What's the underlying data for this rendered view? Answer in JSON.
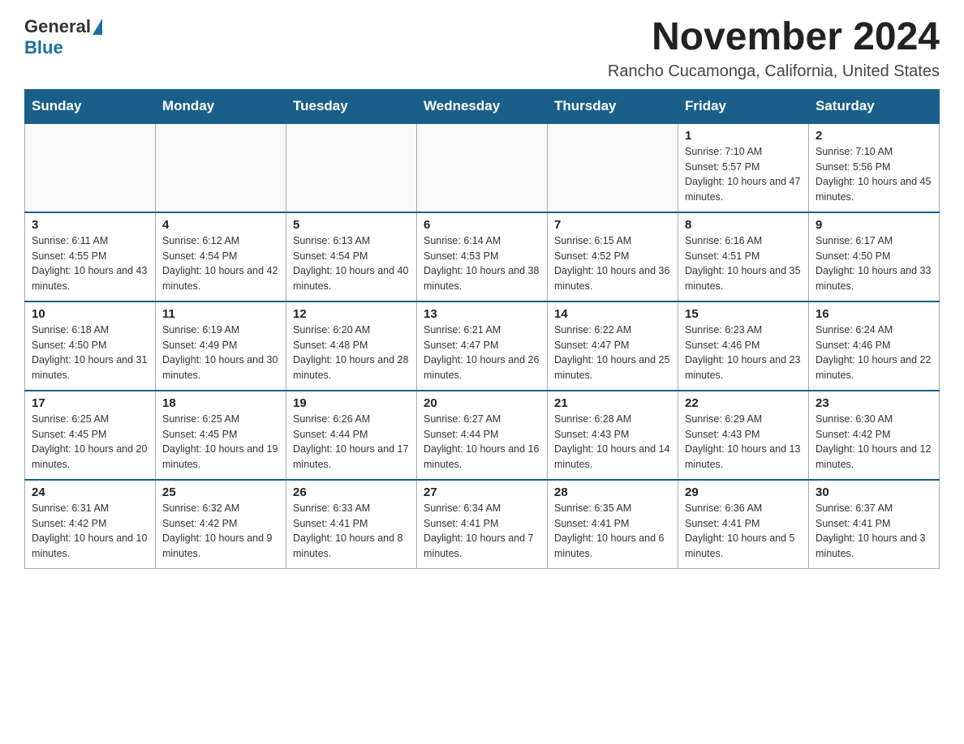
{
  "logo": {
    "general": "General",
    "blue": "Blue"
  },
  "title": {
    "month_year": "November 2024",
    "location": "Rancho Cucamonga, California, United States"
  },
  "days_of_week": [
    "Sunday",
    "Monday",
    "Tuesday",
    "Wednesday",
    "Thursday",
    "Friday",
    "Saturday"
  ],
  "weeks": [
    [
      {
        "day": "",
        "info": ""
      },
      {
        "day": "",
        "info": ""
      },
      {
        "day": "",
        "info": ""
      },
      {
        "day": "",
        "info": ""
      },
      {
        "day": "",
        "info": ""
      },
      {
        "day": "1",
        "info": "Sunrise: 7:10 AM\nSunset: 5:57 PM\nDaylight: 10 hours and 47 minutes."
      },
      {
        "day": "2",
        "info": "Sunrise: 7:10 AM\nSunset: 5:56 PM\nDaylight: 10 hours and 45 minutes."
      }
    ],
    [
      {
        "day": "3",
        "info": "Sunrise: 6:11 AM\nSunset: 4:55 PM\nDaylight: 10 hours and 43 minutes."
      },
      {
        "day": "4",
        "info": "Sunrise: 6:12 AM\nSunset: 4:54 PM\nDaylight: 10 hours and 42 minutes."
      },
      {
        "day": "5",
        "info": "Sunrise: 6:13 AM\nSunset: 4:54 PM\nDaylight: 10 hours and 40 minutes."
      },
      {
        "day": "6",
        "info": "Sunrise: 6:14 AM\nSunset: 4:53 PM\nDaylight: 10 hours and 38 minutes."
      },
      {
        "day": "7",
        "info": "Sunrise: 6:15 AM\nSunset: 4:52 PM\nDaylight: 10 hours and 36 minutes."
      },
      {
        "day": "8",
        "info": "Sunrise: 6:16 AM\nSunset: 4:51 PM\nDaylight: 10 hours and 35 minutes."
      },
      {
        "day": "9",
        "info": "Sunrise: 6:17 AM\nSunset: 4:50 PM\nDaylight: 10 hours and 33 minutes."
      }
    ],
    [
      {
        "day": "10",
        "info": "Sunrise: 6:18 AM\nSunset: 4:50 PM\nDaylight: 10 hours and 31 minutes."
      },
      {
        "day": "11",
        "info": "Sunrise: 6:19 AM\nSunset: 4:49 PM\nDaylight: 10 hours and 30 minutes."
      },
      {
        "day": "12",
        "info": "Sunrise: 6:20 AM\nSunset: 4:48 PM\nDaylight: 10 hours and 28 minutes."
      },
      {
        "day": "13",
        "info": "Sunrise: 6:21 AM\nSunset: 4:47 PM\nDaylight: 10 hours and 26 minutes."
      },
      {
        "day": "14",
        "info": "Sunrise: 6:22 AM\nSunset: 4:47 PM\nDaylight: 10 hours and 25 minutes."
      },
      {
        "day": "15",
        "info": "Sunrise: 6:23 AM\nSunset: 4:46 PM\nDaylight: 10 hours and 23 minutes."
      },
      {
        "day": "16",
        "info": "Sunrise: 6:24 AM\nSunset: 4:46 PM\nDaylight: 10 hours and 22 minutes."
      }
    ],
    [
      {
        "day": "17",
        "info": "Sunrise: 6:25 AM\nSunset: 4:45 PM\nDaylight: 10 hours and 20 minutes."
      },
      {
        "day": "18",
        "info": "Sunrise: 6:25 AM\nSunset: 4:45 PM\nDaylight: 10 hours and 19 minutes."
      },
      {
        "day": "19",
        "info": "Sunrise: 6:26 AM\nSunset: 4:44 PM\nDaylight: 10 hours and 17 minutes."
      },
      {
        "day": "20",
        "info": "Sunrise: 6:27 AM\nSunset: 4:44 PM\nDaylight: 10 hours and 16 minutes."
      },
      {
        "day": "21",
        "info": "Sunrise: 6:28 AM\nSunset: 4:43 PM\nDaylight: 10 hours and 14 minutes."
      },
      {
        "day": "22",
        "info": "Sunrise: 6:29 AM\nSunset: 4:43 PM\nDaylight: 10 hours and 13 minutes."
      },
      {
        "day": "23",
        "info": "Sunrise: 6:30 AM\nSunset: 4:42 PM\nDaylight: 10 hours and 12 minutes."
      }
    ],
    [
      {
        "day": "24",
        "info": "Sunrise: 6:31 AM\nSunset: 4:42 PM\nDaylight: 10 hours and 10 minutes."
      },
      {
        "day": "25",
        "info": "Sunrise: 6:32 AM\nSunset: 4:42 PM\nDaylight: 10 hours and 9 minutes."
      },
      {
        "day": "26",
        "info": "Sunrise: 6:33 AM\nSunset: 4:41 PM\nDaylight: 10 hours and 8 minutes."
      },
      {
        "day": "27",
        "info": "Sunrise: 6:34 AM\nSunset: 4:41 PM\nDaylight: 10 hours and 7 minutes."
      },
      {
        "day": "28",
        "info": "Sunrise: 6:35 AM\nSunset: 4:41 PM\nDaylight: 10 hours and 6 minutes."
      },
      {
        "day": "29",
        "info": "Sunrise: 6:36 AM\nSunset: 4:41 PM\nDaylight: 10 hours and 5 minutes."
      },
      {
        "day": "30",
        "info": "Sunrise: 6:37 AM\nSunset: 4:41 PM\nDaylight: 10 hours and 3 minutes."
      }
    ]
  ]
}
